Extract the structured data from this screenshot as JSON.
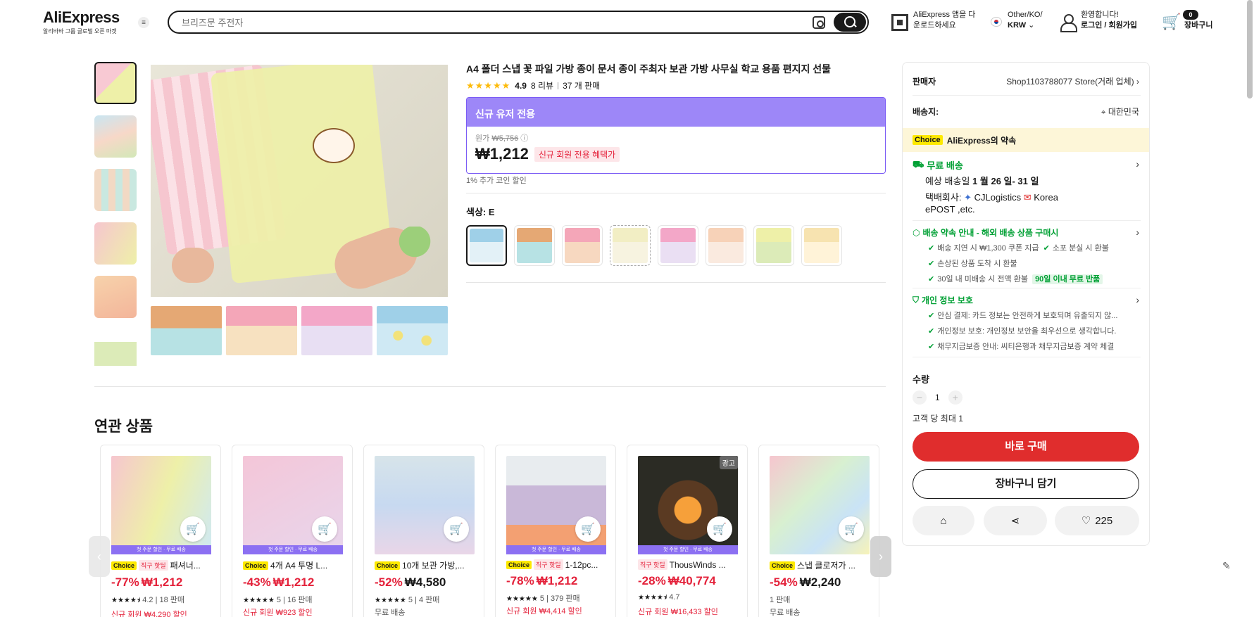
{
  "header": {
    "brand": "AliExpress",
    "tagline": "알리바바 그룹 글로벌 오픈 마켓",
    "search_placeholder": "브리즈문 주전자",
    "app_line1": "AliExpress 앱을 다",
    "app_line2": "운로드하세요",
    "region_line1": "Other/KO/",
    "region_line2": "KRW",
    "welcome": "환영합니다!",
    "login": "로그인 / 회원가입",
    "cart_count": "0",
    "cart_label": "장바구니"
  },
  "product": {
    "title": "A4 폴더 스냅 꽃 파일 가방 종이 문서 종이 주최자 보관 가방 사무실 학교 용품 편지지 선물",
    "stars": "★★★★★",
    "rating": "4.9",
    "reviews": "8 리뷰",
    "sold": "37 개 판매",
    "promo_header": "신규 유저 전용",
    "orig_label": "원가",
    "orig_price": "₩5,756",
    "info_icon": "ⓘ",
    "price": "₩1,212",
    "price_tag": "신규 회원 전용 혜택가",
    "coin": "1% 추가 코인 할인",
    "color_label": "색상: E",
    "swatch_count": 8
  },
  "related": {
    "title": "연관 상품",
    "banner": "첫 주문 할인 · 무료 배송",
    "cards": [
      {
        "badges": [
          "Choice",
          "직구 핫딜"
        ],
        "name": "패셔너...",
        "disc": "-77%",
        "price": "₩1,212",
        "meta_stars": "★★★★⯨",
        "meta": "4.2 | 18 판매",
        "sub": "신규 회원 ₩4,290 할인",
        "ad": ""
      },
      {
        "badges": [
          "Choice"
        ],
        "name": "4개 A4 투명 L...",
        "disc": "-43%",
        "price": "₩1,212",
        "meta_stars": "★★★★★",
        "meta": "5 | 16 판매",
        "sub": "신규 회원 ₩923 할인",
        "ad": ""
      },
      {
        "badges": [
          "Choice"
        ],
        "name": "10개 보관 가방,...",
        "disc": "-52%",
        "price": "₩4,580",
        "meta_stars": "★★★★★",
        "meta": "5 | 4 판매",
        "sub": "무료 배송",
        "ad": ""
      },
      {
        "badges": [
          "Choice",
          "직구 핫딜"
        ],
        "name": "1-12pc...",
        "disc": "-78%",
        "price": "₩1,212",
        "meta_stars": "★★★★★",
        "meta": "5 | 379 판매",
        "sub": "신규 회원 ₩4,414 할인",
        "ad": ""
      },
      {
        "badges": [
          "직구 핫딜"
        ],
        "name": "ThousWinds ...",
        "disc": "-28%",
        "price": "₩40,774",
        "meta_stars": "★★★★⯨",
        "meta": "4.7",
        "sub": "신규 회원 ₩16,433 할인",
        "ad": "광고"
      },
      {
        "badges": [
          "Choice"
        ],
        "name": "스냅 클로저가 ...",
        "disc": "-54%",
        "price": "₩2,240",
        "meta_stars": "",
        "meta": "1 판매",
        "sub": "무료 배송",
        "ad": ""
      }
    ]
  },
  "panel": {
    "seller_label": "판매자",
    "seller_value": "Shop1103788077 Store(거래 업체)",
    "ship_label": "배송지:",
    "ship_value": "대한민국",
    "choice_badge": "Choice",
    "choice_text": "AliExpress의 약속",
    "free_ship": "무료 배송",
    "delivery_prefix": "예상 배송일",
    "delivery_dates": "1 월 26 일- 31 일",
    "carrier_label": "택배회사:",
    "carrier1": "CJLogistics",
    "carrier2": "Korea",
    "carrier3": "ePOST ,etc.",
    "promise_title": "배송 약속 안내 - 해외 배송 상품 구매시",
    "promise_items": [
      "배송 지연 시 ₩1,300 쿠폰 지급",
      "소포 분실 시 환불",
      "손상된 상품 도착 시 환불",
      "30일 내 미배송 시 전액 환불"
    ],
    "return_badge": "90일 이내 무료 반품",
    "privacy_title": "개인 정보 보호",
    "privacy_items": [
      "안심 결제: 카드 정보는 안전하게 보호되며 유출되지 않...",
      "개인정보 보호: 개인정보 보안을 최우선으로 생각합니다.",
      "채무지급보증 안내: 씨티은행과 채무지급보증 계약 체결"
    ],
    "qty_label": "수량",
    "qty_value": "1",
    "qty_limit": "고객 당 최대 1",
    "buy_now": "바로 구매",
    "add_cart": "장바구니 담기",
    "wish_count": "225"
  },
  "colors": {
    "accent_red": "#e02d2d",
    "promo_purple": "#9d87f8",
    "choice_yellow": "#fde900",
    "green": "#00a034"
  }
}
